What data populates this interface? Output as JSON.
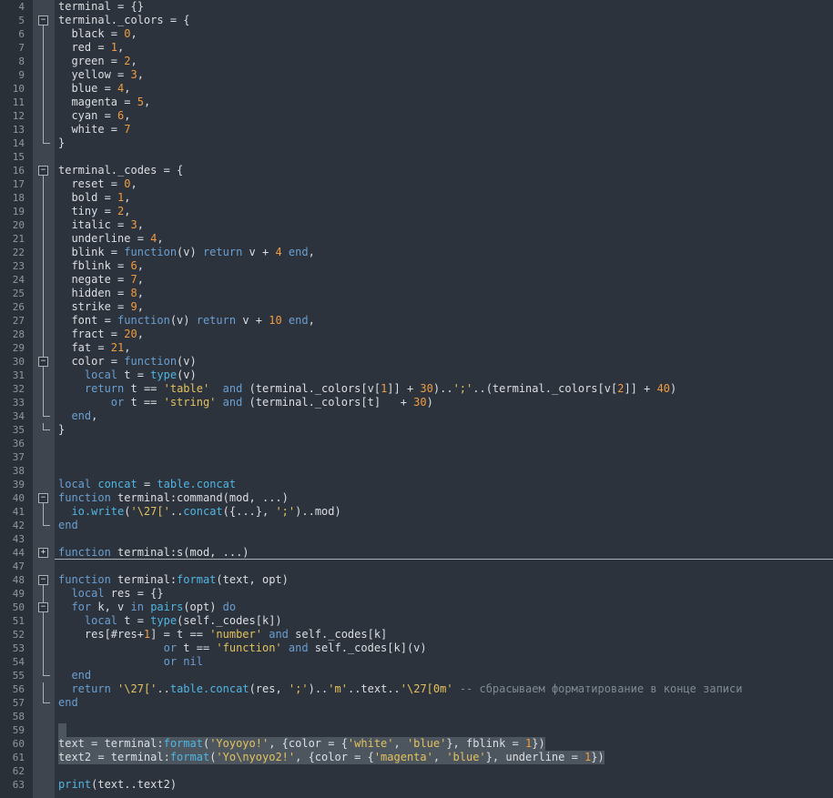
{
  "app": {
    "type": "code-editor",
    "language": "lua"
  },
  "colors": {
    "bg": "#2d333c",
    "margin_bg": "#2a3038",
    "fold_bg": "#3e454e",
    "selection": "#4d565f",
    "linenum": "#8f989f",
    "default": "#dcdfe3",
    "keyword": "#6a9fd2",
    "builtin": "#4fb6e3",
    "number": "#f09c42",
    "string": "#e3c25e",
    "comment": "#7e8a94",
    "fold_stroke": "#a9b0b6",
    "fold_glyph": "#e0e4e7"
  },
  "icons": {
    "fold_open_glyph": "−",
    "fold_closed_glyph": "+"
  },
  "editor": {
    "first_visible_line": 4,
    "last_visible_line": 63,
    "folded_range": "45-46",
    "lines": [
      {
        "n": 4,
        "f": "",
        "tokens": [
          [
            "d",
            "terminal = {}"
          ]
        ]
      },
      {
        "n": 5,
        "f": "o",
        "tokens": [
          [
            "d",
            "terminal._colors = {"
          ]
        ]
      },
      {
        "n": 6,
        "f": "l",
        "tokens": [
          [
            "d",
            "  black = "
          ],
          [
            "n",
            "0"
          ],
          [
            "d",
            ","
          ]
        ]
      },
      {
        "n": 7,
        "f": "l",
        "tokens": [
          [
            "d",
            "  red = "
          ],
          [
            "n",
            "1"
          ],
          [
            "d",
            ","
          ]
        ]
      },
      {
        "n": 8,
        "f": "l",
        "tokens": [
          [
            "d",
            "  green = "
          ],
          [
            "n",
            "2"
          ],
          [
            "d",
            ","
          ]
        ]
      },
      {
        "n": 9,
        "f": "l",
        "tokens": [
          [
            "d",
            "  yellow = "
          ],
          [
            "n",
            "3"
          ],
          [
            "d",
            ","
          ]
        ]
      },
      {
        "n": 10,
        "f": "l",
        "tokens": [
          [
            "d",
            "  blue = "
          ],
          [
            "n",
            "4"
          ],
          [
            "d",
            ","
          ]
        ]
      },
      {
        "n": 11,
        "f": "l",
        "tokens": [
          [
            "d",
            "  magenta = "
          ],
          [
            "n",
            "5"
          ],
          [
            "d",
            ","
          ]
        ]
      },
      {
        "n": 12,
        "f": "l",
        "tokens": [
          [
            "d",
            "  cyan = "
          ],
          [
            "n",
            "6"
          ],
          [
            "d",
            ","
          ]
        ]
      },
      {
        "n": 13,
        "f": "l",
        "tokens": [
          [
            "d",
            "  white = "
          ],
          [
            "n",
            "7"
          ]
        ]
      },
      {
        "n": 14,
        "f": "e",
        "tokens": [
          [
            "d",
            "}"
          ]
        ]
      },
      {
        "n": 15,
        "f": "",
        "tokens": []
      },
      {
        "n": 16,
        "f": "o",
        "tokens": [
          [
            "d",
            "terminal._codes = {"
          ]
        ]
      },
      {
        "n": 17,
        "f": "l",
        "tokens": [
          [
            "d",
            "  reset = "
          ],
          [
            "n",
            "0"
          ],
          [
            "d",
            ","
          ]
        ]
      },
      {
        "n": 18,
        "f": "l",
        "tokens": [
          [
            "d",
            "  bold = "
          ],
          [
            "n",
            "1"
          ],
          [
            "d",
            ","
          ]
        ]
      },
      {
        "n": 19,
        "f": "l",
        "tokens": [
          [
            "d",
            "  tiny = "
          ],
          [
            "n",
            "2"
          ],
          [
            "d",
            ","
          ]
        ]
      },
      {
        "n": 20,
        "f": "l",
        "tokens": [
          [
            "d",
            "  italic = "
          ],
          [
            "n",
            "3"
          ],
          [
            "d",
            ","
          ]
        ]
      },
      {
        "n": 21,
        "f": "l",
        "tokens": [
          [
            "d",
            "  underline = "
          ],
          [
            "n",
            "4"
          ],
          [
            "d",
            ","
          ]
        ]
      },
      {
        "n": 22,
        "f": "l",
        "tokens": [
          [
            "d",
            "  blink = "
          ],
          [
            "k",
            "function"
          ],
          [
            "d",
            "(v) "
          ],
          [
            "k",
            "return"
          ],
          [
            "d",
            " v + "
          ],
          [
            "n",
            "4"
          ],
          [
            "d",
            " "
          ],
          [
            "k",
            "end"
          ],
          [
            "d",
            ","
          ]
        ]
      },
      {
        "n": 23,
        "f": "l",
        "tokens": [
          [
            "d",
            "  fblink = "
          ],
          [
            "n",
            "6"
          ],
          [
            "d",
            ","
          ]
        ]
      },
      {
        "n": 24,
        "f": "l",
        "tokens": [
          [
            "d",
            "  negate = "
          ],
          [
            "n",
            "7"
          ],
          [
            "d",
            ","
          ]
        ]
      },
      {
        "n": 25,
        "f": "l",
        "tokens": [
          [
            "d",
            "  hidden = "
          ],
          [
            "n",
            "8"
          ],
          [
            "d",
            ","
          ]
        ]
      },
      {
        "n": 26,
        "f": "l",
        "tokens": [
          [
            "d",
            "  strike = "
          ],
          [
            "n",
            "9"
          ],
          [
            "d",
            ","
          ]
        ]
      },
      {
        "n": 27,
        "f": "l",
        "tokens": [
          [
            "d",
            "  font = "
          ],
          [
            "k",
            "function"
          ],
          [
            "d",
            "(v) "
          ],
          [
            "k",
            "return"
          ],
          [
            "d",
            " v + "
          ],
          [
            "n",
            "10"
          ],
          [
            "d",
            " "
          ],
          [
            "k",
            "end"
          ],
          [
            "d",
            ","
          ]
        ]
      },
      {
        "n": 28,
        "f": "l",
        "tokens": [
          [
            "d",
            "  fract = "
          ],
          [
            "n",
            "20"
          ],
          [
            "d",
            ","
          ]
        ]
      },
      {
        "n": 29,
        "f": "l",
        "tokens": [
          [
            "d",
            "  fat = "
          ],
          [
            "n",
            "21"
          ],
          [
            "d",
            ","
          ]
        ]
      },
      {
        "n": 30,
        "f": "on",
        "tokens": [
          [
            "d",
            "  color = "
          ],
          [
            "k",
            "function"
          ],
          [
            "d",
            "(v)"
          ]
        ]
      },
      {
        "n": 31,
        "f": "l",
        "tokens": [
          [
            "d",
            "    "
          ],
          [
            "k",
            "local"
          ],
          [
            "d",
            " t = "
          ],
          [
            "f",
            "type"
          ],
          [
            "d",
            "(v)"
          ]
        ]
      },
      {
        "n": 32,
        "f": "l",
        "tokens": [
          [
            "d",
            "    "
          ],
          [
            "k",
            "return"
          ],
          [
            "d",
            " t == "
          ],
          [
            "s",
            "'table'"
          ],
          [
            "d",
            "  "
          ],
          [
            "k",
            "and"
          ],
          [
            "d",
            " (terminal._colors[v["
          ],
          [
            "n",
            "1"
          ],
          [
            "d",
            "]] + "
          ],
          [
            "n",
            "30"
          ],
          [
            "d",
            ").."
          ],
          [
            "s",
            "';'"
          ],
          [
            "d",
            "..(terminal._colors[v["
          ],
          [
            "n",
            "2"
          ],
          [
            "d",
            "]] + "
          ],
          [
            "n",
            "40"
          ],
          [
            "d",
            ")"
          ]
        ]
      },
      {
        "n": 33,
        "f": "l",
        "tokens": [
          [
            "d",
            "        "
          ],
          [
            "k",
            "or"
          ],
          [
            "d",
            " t == "
          ],
          [
            "s",
            "'string'"
          ],
          [
            "d",
            " "
          ],
          [
            "k",
            "and"
          ],
          [
            "d",
            " (terminal._colors[t]   + "
          ],
          [
            "n",
            "30"
          ],
          [
            "d",
            ")"
          ]
        ]
      },
      {
        "n": 34,
        "f": "e",
        "tokens": [
          [
            "d",
            "  "
          ],
          [
            "k",
            "end"
          ],
          [
            "d",
            ","
          ]
        ]
      },
      {
        "n": 35,
        "f": "e",
        "tokens": [
          [
            "d",
            "}"
          ]
        ]
      },
      {
        "n": 36,
        "f": "",
        "tokens": []
      },
      {
        "n": 37,
        "f": "",
        "tokens": []
      },
      {
        "n": 38,
        "f": "",
        "tokens": []
      },
      {
        "n": 39,
        "f": "",
        "tokens": [
          [
            "k",
            "local"
          ],
          [
            "d",
            " "
          ],
          [
            "f",
            "concat"
          ],
          [
            "d",
            " = "
          ],
          [
            "f",
            "table.concat"
          ]
        ]
      },
      {
        "n": 40,
        "f": "o",
        "tokens": [
          [
            "k",
            "function"
          ],
          [
            "d",
            " terminal:command(mod, ...)"
          ]
        ]
      },
      {
        "n": 41,
        "f": "l",
        "tokens": [
          [
            "d",
            "  "
          ],
          [
            "f",
            "io.write"
          ],
          [
            "d",
            "("
          ],
          [
            "s",
            "'\\27['"
          ],
          [
            "d",
            ".."
          ],
          [
            "f",
            "concat"
          ],
          [
            "d",
            "({...}, "
          ],
          [
            "s",
            "';'"
          ],
          [
            "d",
            ")..mod)"
          ]
        ]
      },
      {
        "n": 42,
        "f": "e",
        "tokens": [
          [
            "k",
            "end"
          ]
        ]
      },
      {
        "n": 43,
        "f": "",
        "tokens": []
      },
      {
        "n": 44,
        "f": "c",
        "foldline": true,
        "tokens": [
          [
            "k",
            "function"
          ],
          [
            "d",
            " terminal:s(mod, ...)"
          ]
        ]
      },
      {
        "n": 47,
        "f": "",
        "tokens": []
      },
      {
        "n": 48,
        "f": "o",
        "tokens": [
          [
            "k",
            "function"
          ],
          [
            "d",
            " terminal:"
          ],
          [
            "f",
            "format"
          ],
          [
            "d",
            "(text, opt)"
          ]
        ]
      },
      {
        "n": 49,
        "f": "l",
        "tokens": [
          [
            "d",
            "  "
          ],
          [
            "k",
            "local"
          ],
          [
            "d",
            " res = {}"
          ]
        ]
      },
      {
        "n": 50,
        "f": "on",
        "tokens": [
          [
            "d",
            "  "
          ],
          [
            "k",
            "for"
          ],
          [
            "d",
            " k, v "
          ],
          [
            "k",
            "in"
          ],
          [
            "d",
            " "
          ],
          [
            "f",
            "pairs"
          ],
          [
            "d",
            "(opt) "
          ],
          [
            "k",
            "do"
          ]
        ]
      },
      {
        "n": 51,
        "f": "l",
        "tokens": [
          [
            "d",
            "    "
          ],
          [
            "k",
            "local"
          ],
          [
            "d",
            " t = "
          ],
          [
            "f",
            "type"
          ],
          [
            "d",
            "(self._codes[k])"
          ]
        ]
      },
      {
        "n": 52,
        "f": "l",
        "tokens": [
          [
            "d",
            "    res[#res+"
          ],
          [
            "n",
            "1"
          ],
          [
            "d",
            "] = t == "
          ],
          [
            "s",
            "'number'"
          ],
          [
            "d",
            " "
          ],
          [
            "k",
            "and"
          ],
          [
            "d",
            " self._codes[k]"
          ]
        ]
      },
      {
        "n": 53,
        "f": "l",
        "tokens": [
          [
            "d",
            "                "
          ],
          [
            "k",
            "or"
          ],
          [
            "d",
            " t == "
          ],
          [
            "s",
            "'function'"
          ],
          [
            "d",
            " "
          ],
          [
            "k",
            "and"
          ],
          [
            "d",
            " self._codes[k](v)"
          ]
        ]
      },
      {
        "n": 54,
        "f": "l",
        "tokens": [
          [
            "d",
            "                "
          ],
          [
            "k",
            "or"
          ],
          [
            "d",
            " "
          ],
          [
            "k",
            "nil"
          ]
        ]
      },
      {
        "n": 55,
        "f": "e",
        "tokens": [
          [
            "d",
            "  "
          ],
          [
            "k",
            "end"
          ]
        ]
      },
      {
        "n": 56,
        "f": "l",
        "tokens": [
          [
            "d",
            "  "
          ],
          [
            "k",
            "return"
          ],
          [
            "d",
            " "
          ],
          [
            "s",
            "'\\27['"
          ],
          [
            "d",
            ".."
          ],
          [
            "f",
            "table.concat"
          ],
          [
            "d",
            "(res, "
          ],
          [
            "s",
            "';'"
          ],
          [
            "d",
            ").."
          ],
          [
            "s",
            "'m'"
          ],
          [
            "d",
            "..text.."
          ],
          [
            "s",
            "'\\27[0m'"
          ],
          [
            "d",
            " "
          ],
          [
            "c",
            "-- сбрасываем форматирование в конце записи"
          ]
        ]
      },
      {
        "n": 57,
        "f": "e",
        "tokens": [
          [
            "k",
            "end"
          ]
        ]
      },
      {
        "n": 58,
        "f": "",
        "tokens": []
      },
      {
        "n": 59,
        "f": "",
        "selchip": true,
        "tokens": []
      },
      {
        "n": 60,
        "f": "",
        "sel": true,
        "tokens": [
          [
            "d",
            "text = terminal:"
          ],
          [
            "f",
            "format"
          ],
          [
            "d",
            "("
          ],
          [
            "s",
            "'Yoyoyo!'"
          ],
          [
            "d",
            ", {color = {"
          ],
          [
            "s",
            "'white'"
          ],
          [
            "d",
            ", "
          ],
          [
            "s",
            "'blue'"
          ],
          [
            "d",
            "}, fblink = "
          ],
          [
            "n",
            "1"
          ],
          [
            "d",
            "})"
          ]
        ]
      },
      {
        "n": 61,
        "f": "",
        "sel": true,
        "tokens": [
          [
            "d",
            "text2 = terminal:"
          ],
          [
            "f",
            "format"
          ],
          [
            "d",
            "("
          ],
          [
            "s",
            "'Yo\\nyoyo2!'"
          ],
          [
            "d",
            ", {color = {"
          ],
          [
            "s",
            "'magenta'"
          ],
          [
            "d",
            ", "
          ],
          [
            "s",
            "'blue'"
          ],
          [
            "d",
            "}, underline = "
          ],
          [
            "n",
            "1"
          ],
          [
            "d",
            "})"
          ]
        ]
      },
      {
        "n": 62,
        "f": "",
        "tokens": []
      },
      {
        "n": 63,
        "f": "",
        "tokens": [
          [
            "f",
            "print"
          ],
          [
            "d",
            "(text..text2)"
          ]
        ]
      }
    ]
  }
}
